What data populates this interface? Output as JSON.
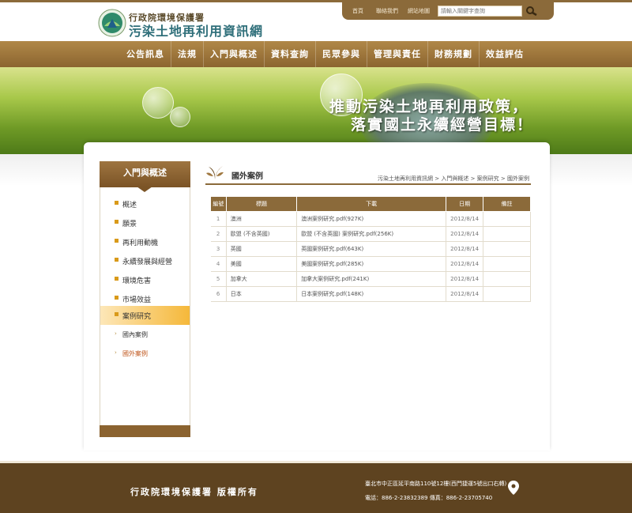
{
  "header": {
    "logo_sub": "行政院環境保護署",
    "logo_main": "污染土地再利用資訊網",
    "util_links": [
      "首頁",
      "聯絡我們",
      "網站地圖"
    ],
    "search_placeholder": "請輸入關鍵字查詢"
  },
  "mainnav": {
    "items": [
      "公告訊息",
      "法規",
      "入門與概述",
      "資料查詢",
      "民眾參與",
      "管理與責任",
      "財務規劃",
      "效益評估"
    ]
  },
  "banner": {
    "slogan_line1": "推動污染土地再利用政策，",
    "slogan_line2": "落實國土永續經營目標！"
  },
  "sidebar": {
    "heading": "入門與概述",
    "items": [
      "概述",
      "願景",
      "再利用動機",
      "永續發展與經營",
      "環境危害",
      "市場效益",
      "案例研究"
    ],
    "active_item": "案例研究",
    "subitems": [
      "國內案例",
      "國外案例"
    ],
    "current_subitem": "國外案例"
  },
  "content": {
    "title": "國外案例",
    "breadcrumb": "污染土地再利用資訊網 > 入門與概述 > 案例研究 > 國外案例",
    "table": {
      "headers": [
        "編號",
        "標題",
        "下載",
        "日期",
        "備註"
      ],
      "rows": [
        [
          "1",
          "澳洲",
          "澳洲案例研究.pdf(927K)",
          "2012/8/14",
          ""
        ],
        [
          "2",
          "歐盟 (不含英國)",
          "歐盟 (不含英國) 案例研究.pdf(256K)",
          "2012/8/14",
          ""
        ],
        [
          "3",
          "英國",
          "英國案例研究.pdf(643K)",
          "2012/8/14",
          ""
        ],
        [
          "4",
          "美國",
          "美國案例研究.pdf(285K)",
          "2012/8/14",
          ""
        ],
        [
          "5",
          "加拿大",
          "加拿大案例研究.pdf(241K)",
          "2012/8/14",
          ""
        ],
        [
          "6",
          "日本",
          "日本案例研究.pdf(148K)",
          "2012/8/14",
          ""
        ]
      ]
    }
  },
  "footer": {
    "copyright": "行政院環境保護署 版權所有",
    "address": "臺北市中正區延平南路110號12樓(西門捷運5號出口右轉)",
    "phone": "電話：886-2-23832389 傳真：886-2-23705740"
  },
  "colors": {
    "brand_brown": "#8b6a3a",
    "accent_orange": "#f5b83a",
    "footer_brown": "#5e4320"
  },
  "icons": [
    "logo-emblem",
    "search-icon",
    "leaf-icon",
    "map-pin-icon"
  ]
}
